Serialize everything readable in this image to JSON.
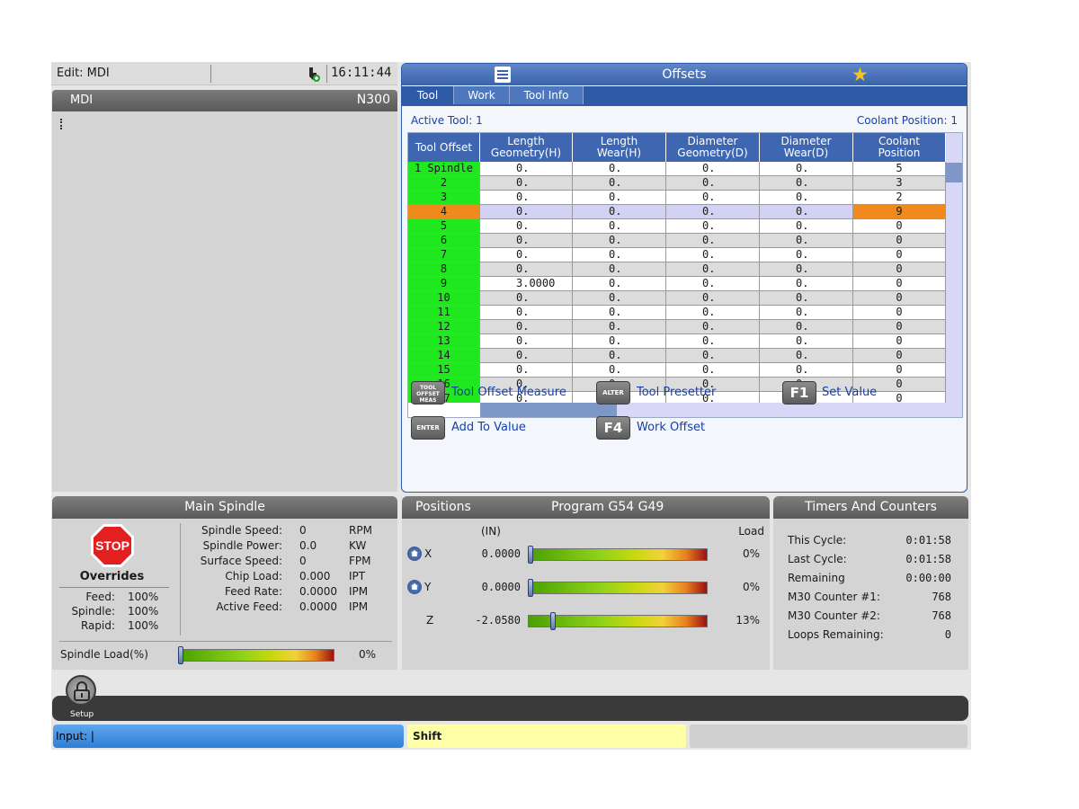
{
  "editbar": {
    "label": "Edit: MDI",
    "time": "16:11:44"
  },
  "mdi": {
    "title": "MDI",
    "line": "N300"
  },
  "offsets": {
    "title": "Offsets",
    "tabs": [
      "Tool",
      "Work",
      "Tool Info"
    ],
    "active_tool_label": "Active Tool:  1",
    "coolant_position_label": "Coolant Position:  1",
    "columns": [
      "Tool Offset",
      "Length\nGeometry(H)",
      "Length\nWear(H)",
      "Diameter\nGeometry(D)",
      "Diameter\nWear(D)",
      "Coolant\nPosition"
    ],
    "rows": [
      [
        "1 Spindle",
        "0.",
        "0.",
        "0.",
        "0.",
        "5"
      ],
      [
        "2",
        "0.",
        "0.",
        "0.",
        "0.",
        "3"
      ],
      [
        "3",
        "0.",
        "0.",
        "0.",
        "0.",
        "2"
      ],
      [
        "4",
        "0.",
        "0.",
        "0.",
        "0.",
        "9"
      ],
      [
        "5",
        "0.",
        "0.",
        "0.",
        "0.",
        "0"
      ],
      [
        "6",
        "0.",
        "0.",
        "0.",
        "0.",
        "0"
      ],
      [
        "7",
        "0.",
        "0.",
        "0.",
        "0.",
        "0"
      ],
      [
        "8",
        "0.",
        "0.",
        "0.",
        "0.",
        "0"
      ],
      [
        "9",
        "3.0000",
        "0.",
        "0.",
        "0.",
        "0"
      ],
      [
        "10",
        "0.",
        "0.",
        "0.",
        "0.",
        "0"
      ],
      [
        "11",
        "0.",
        "0.",
        "0.",
        "0.",
        "0"
      ],
      [
        "12",
        "0.",
        "0.",
        "0.",
        "0.",
        "0"
      ],
      [
        "13",
        "0.",
        "0.",
        "0.",
        "0.",
        "0"
      ],
      [
        "14",
        "0.",
        "0.",
        "0.",
        "0.",
        "0"
      ],
      [
        "15",
        "0.",
        "0.",
        "0.",
        "0.",
        "0"
      ],
      [
        "16",
        "0.",
        "0.",
        "0.",
        "0.",
        "0"
      ],
      [
        "17",
        "0.",
        "0.",
        "0.",
        "0.",
        "0"
      ]
    ],
    "selected_row": 3,
    "keys": {
      "tool_offset_key": "TOOL OFFSET MEAS",
      "tool_offset_label": "Tool Offset Measure",
      "alter_key": "ALTER",
      "alter_label": "Tool Presetter",
      "f1_key": "F1",
      "f1_label": "Set Value",
      "enter_key": "ENTER",
      "enter_label": "Add To Value",
      "f4_key": "F4",
      "f4_label": "Work Offset"
    }
  },
  "spindle": {
    "title": "Main Spindle",
    "stop": "STOP",
    "overrides_title": "Overrides",
    "overrides": [
      {
        "k": "Feed:",
        "v": "100%"
      },
      {
        "k": "Spindle:",
        "v": "100%"
      },
      {
        "k": "Rapid:",
        "v": "100%"
      }
    ],
    "rows": [
      {
        "k": "Spindle Speed:",
        "v": "0",
        "u": "RPM"
      },
      {
        "k": "Spindle Power:",
        "v": "0.0",
        "u": "KW"
      },
      {
        "k": "Surface Speed:",
        "v": "0",
        "u": "FPM"
      },
      {
        "k": "Chip Load:",
        "v": "0.000",
        "u": "IPT"
      },
      {
        "k": "Feed Rate:",
        "v": "0.0000",
        "u": "IPM"
      },
      {
        "k": "Active Feed:",
        "v": "0.0000",
        "u": "IPM"
      }
    ],
    "load_label": "Spindle Load(%)",
    "load_pct": "0%",
    "load_fraction": 0
  },
  "positions": {
    "title": "Positions",
    "program": "Program G54 G49",
    "unit": "(IN)",
    "load_label": "Load",
    "axes": [
      {
        "name": "X",
        "value": "0.0000",
        "pct": "0%",
        "fraction": 0.0
      },
      {
        "name": "Y",
        "value": "0.0000",
        "pct": "0%",
        "fraction": 0.0
      },
      {
        "name": "Z",
        "value": "-2.0580",
        "pct": "13%",
        "fraction": 0.13
      }
    ]
  },
  "timers": {
    "title": "Timers And Counters",
    "rows": [
      {
        "k": "This Cycle:",
        "v": "0:01:58"
      },
      {
        "k": "Last Cycle:",
        "v": "0:01:58"
      },
      {
        "k": "Remaining",
        "v": "0:00:00"
      },
      {
        "k": "M30 Counter #1:",
        "v": "768"
      },
      {
        "k": "M30 Counter #2:",
        "v": "768"
      },
      {
        "k": "Loops Remaining:",
        "v": "0"
      }
    ]
  },
  "footer": {
    "setup": "Setup",
    "input": "Input:  |",
    "shift": "Shift"
  },
  "colors": {
    "tool_green": "#1fe81f",
    "selected_orange": "#f08a1c",
    "offset_blue": "#3b63ab"
  }
}
